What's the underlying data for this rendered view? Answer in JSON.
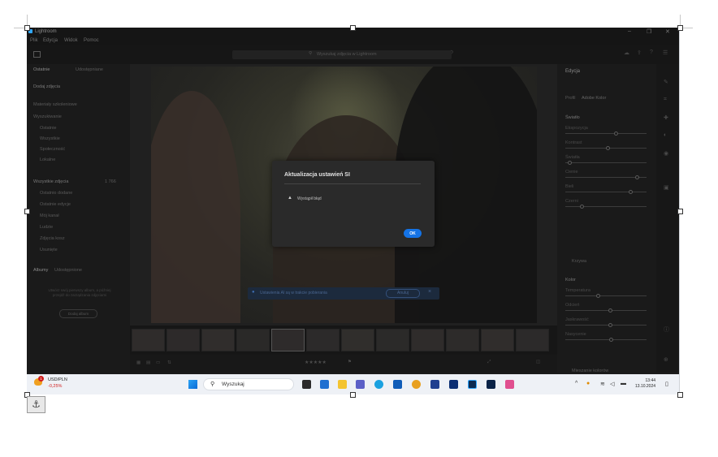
{
  "window": {
    "app_title": "Lightroom",
    "controls": [
      "–",
      "❐",
      "✕"
    ]
  },
  "menu": [
    "Plik",
    "Edycja",
    "Widok",
    "Pomoc"
  ],
  "toolbar": {
    "search_placeholder": "Wyszukaj zdjęcia w Lightroom"
  },
  "left_panel": {
    "tabs": [
      "Ostatnie",
      "Udostępniane"
    ],
    "add_photos": "Dodaj zdjęcia",
    "learn": "Materiały szkoleniowe",
    "sections": [
      "Wyszukiwanie",
      "Ostatnie",
      "Wszystkie",
      "Społeczność",
      "Lokalne"
    ],
    "all_photos": "Wszystkie zdjęcia",
    "all_photos_count": "1 766",
    "items": [
      "Ostatnio dodane",
      "Ostatnie edycje",
      "Mój kanał",
      "Ludzie",
      "Zdjęcia kosz",
      "Usunięte"
    ],
    "albums_tabs": [
      "Albumy",
      "Udostępnione"
    ],
    "albums_hint": "Utwórz swój pierwszy album, a później przejdź do zarządzania zdjęciami",
    "create_album": "Dodaj album"
  },
  "right_panel": {
    "title": "Edycja",
    "profile_label": "Profil",
    "profile_value": "Adobe Kolor",
    "sections": [
      "Światło",
      "Kolor"
    ],
    "light_sliders": [
      {
        "label": "Ekspozycja",
        "value": 0.62
      },
      {
        "label": "Kontrast",
        "value": 0.52
      },
      {
        "label": "Światła",
        "value": 0.05
      },
      {
        "label": "Cienie",
        "value": 0.88
      },
      {
        "label": "Bieli",
        "value": 0.8
      },
      {
        "label": "Czerni",
        "value": 0.2
      }
    ],
    "curve_label": "Krzywa",
    "color_sliders": [
      {
        "label": "Temperatura",
        "value": 0.4
      },
      {
        "label": "Odcień",
        "value": 0.55
      },
      {
        "label": "Jaskrawość",
        "value": 0.55
      },
      {
        "label": "Nasycenie",
        "value": 0.56
      }
    ],
    "color_mix": "Mieszanie kolorów"
  },
  "banner": {
    "text": "Ustawienia AI są w trakcie pobierania",
    "cancel": "Anuluj",
    "close": "×"
  },
  "dialog": {
    "title": "Aktualizacja ustawień SI",
    "warning_icon": "warning-icon",
    "message": "Wystąpił błąd",
    "ok": "OK"
  },
  "taskbar": {
    "stock_name": "USD/PLN",
    "stock_change": "-0,25%",
    "stock_badge": "1",
    "search_text": "Wyszukaj",
    "time": "13:44",
    "date": "13.10.2024"
  },
  "colors": {
    "accent": "#1473e6",
    "dialog_bg": "#2a2a2a",
    "taskbar_bg": "#eef1f6",
    "stock_negative": "#d11f1f"
  }
}
